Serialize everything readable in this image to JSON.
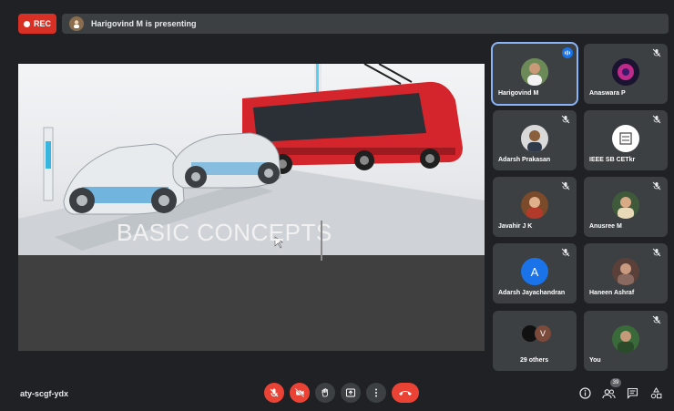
{
  "top_bar": {
    "rec_label": "REC",
    "presenting_text": "Harigovind M is presenting"
  },
  "slide": {
    "title": "BASIC CONCEPTS"
  },
  "participants": [
    {
      "name": "Harigovind M",
      "muted": false,
      "speaking": true,
      "avatar": "photo"
    },
    {
      "name": "Anaswara P",
      "muted": true,
      "avatar": "photo"
    },
    {
      "name": "Adarsh Prakasan",
      "muted": true,
      "avatar": "photo"
    },
    {
      "name": "IEEE SB CETkr",
      "muted": true,
      "avatar": "logo"
    },
    {
      "name": "Javahir J K",
      "muted": true,
      "avatar": "photo"
    },
    {
      "name": "Anusree M",
      "muted": true,
      "avatar": "photo"
    },
    {
      "name": "Adarsh Jayachandran",
      "muted": true,
      "avatar": "A",
      "avatar_color": "#1a73e8"
    },
    {
      "name": "Haneen Ashraf",
      "muted": true,
      "avatar": "photo"
    },
    {
      "name": "29 others",
      "avatar_letter": "V"
    },
    {
      "name": "You",
      "muted": true,
      "avatar": "photo"
    }
  ],
  "bottom_bar": {
    "meeting_code": "aty-scgf-ydx",
    "people_count": "39"
  },
  "colors": {
    "background": "#202124",
    "tile": "#3c4043",
    "red": "#ea4335",
    "accent": "#8ab4f8"
  }
}
